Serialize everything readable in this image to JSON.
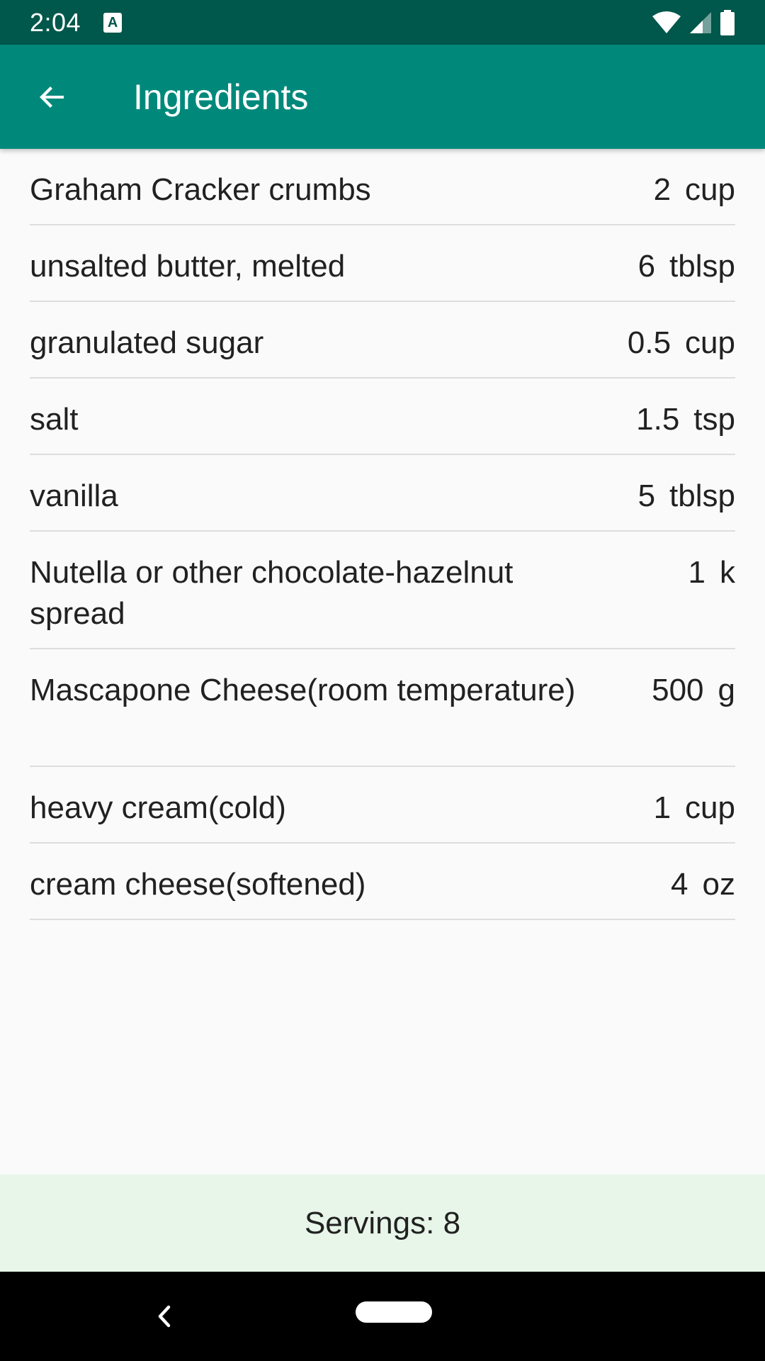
{
  "status_bar": {
    "time": "2:04",
    "notification_icon_glyph": "A"
  },
  "app_bar": {
    "title": "Ingredients",
    "back_icon": "arrow-back-icon"
  },
  "ingredients": [
    {
      "name": "Graham Cracker crumbs",
      "amount": "2",
      "unit": "cup"
    },
    {
      "name": "unsalted butter, melted",
      "amount": "6",
      "unit": "tblsp"
    },
    {
      "name": "granulated sugar",
      "amount": "0.5",
      "unit": "cup"
    },
    {
      "name": "salt",
      "amount": "1.5",
      "unit": "tsp"
    },
    {
      "name": "vanilla",
      "amount": "5",
      "unit": "tblsp"
    },
    {
      "name": "Nutella or other chocolate-hazelnut spread",
      "amount": "1",
      "unit": "k"
    },
    {
      "name": "Mascapone Cheese(room temperature)",
      "amount": "500",
      "unit": "g"
    },
    {
      "name": "heavy cream(cold)",
      "amount": "1",
      "unit": "cup"
    },
    {
      "name": "cream cheese(softened)",
      "amount": "4",
      "unit": "oz"
    }
  ],
  "footer": {
    "servings": "Servings: 8"
  },
  "colors": {
    "status_bar": "#00574b",
    "app_bar": "#00897b",
    "servings_bar": "#e8f5e9",
    "background": "#fafafa"
  }
}
